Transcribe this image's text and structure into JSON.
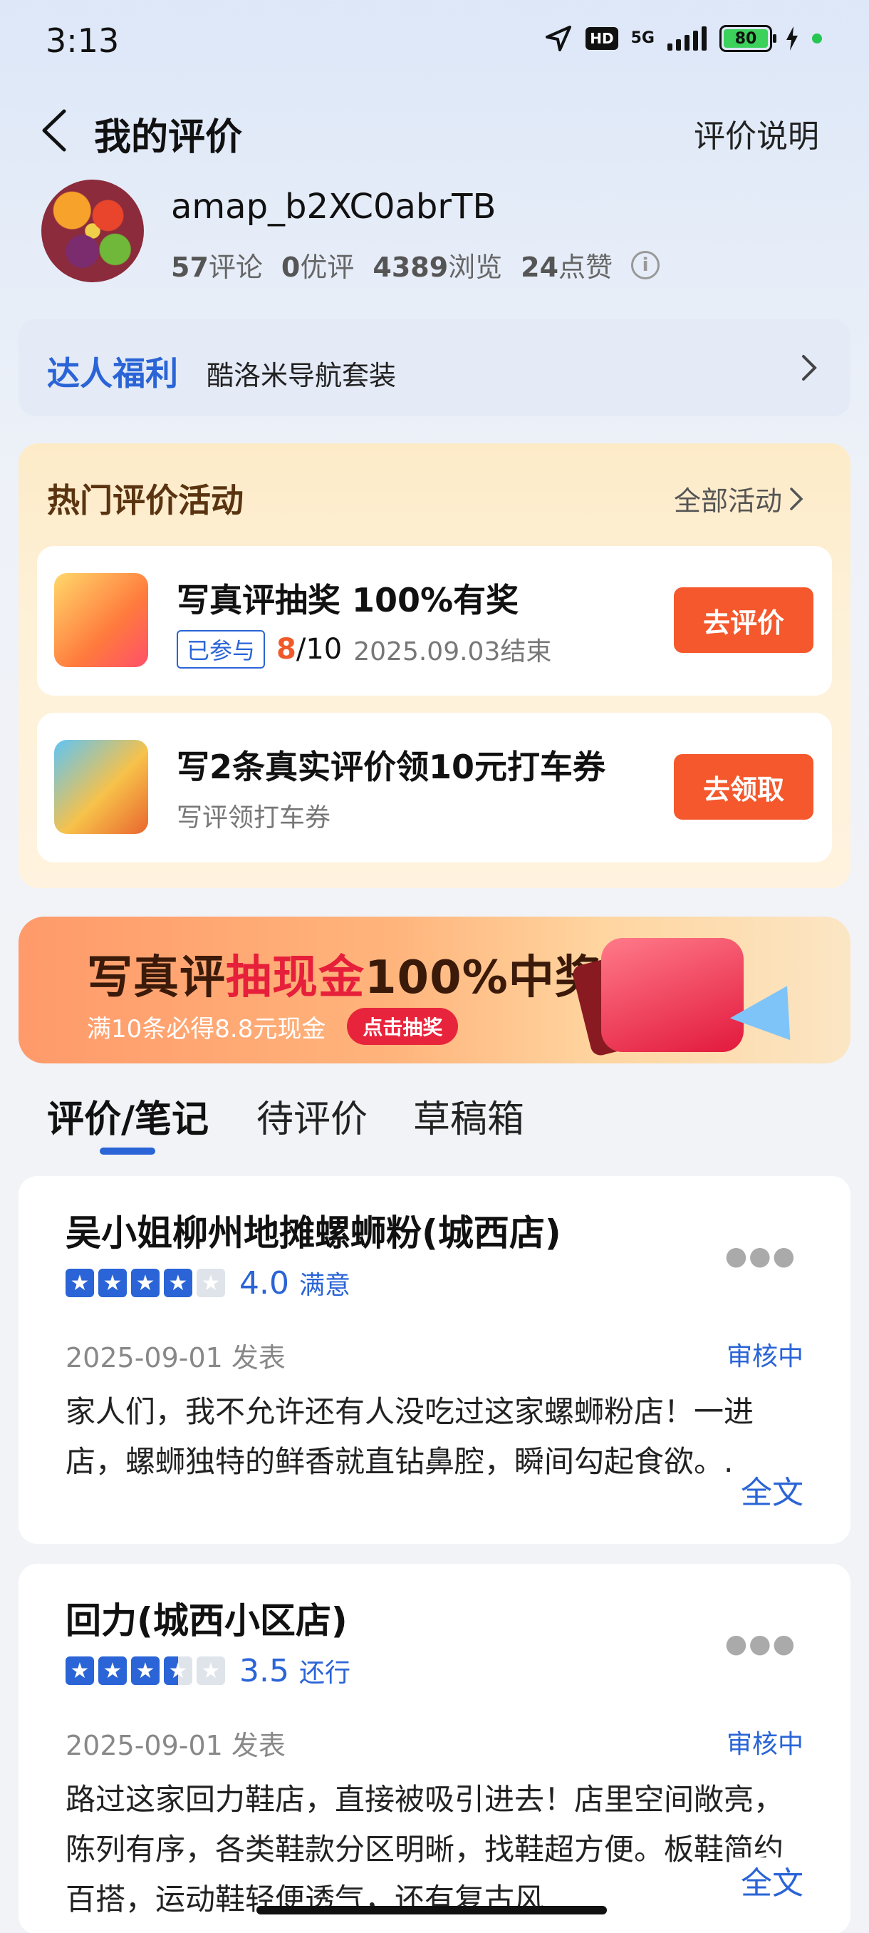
{
  "status_bar": {
    "time": "3:13",
    "hd": "HD",
    "network": "5G",
    "battery": "80"
  },
  "header": {
    "title": "我的评价",
    "right_link": "评价说明"
  },
  "profile": {
    "username": "amap_b2XC0abrTB",
    "stats": [
      {
        "value": "57",
        "label": "评论"
      },
      {
        "value": "0",
        "label": "优评"
      },
      {
        "value": "4389",
        "label": "浏览"
      },
      {
        "value": "24",
        "label": "点赞"
      }
    ]
  },
  "daren": {
    "title": "达人福利",
    "desc": "酷洛米导航套装"
  },
  "activities": {
    "title": "热门评价活动",
    "all_label": "全部活动",
    "items": [
      {
        "name": "写真评抽奖 100%有奖",
        "badge": "已参与",
        "progress_current": "8",
        "progress_total": "/10",
        "deadline": "2025.09.03结束",
        "button": "去评价"
      },
      {
        "name": "写2条真实评价领10元打车券",
        "sub": "写评领打车券",
        "button": "去领取"
      }
    ]
  },
  "banner": {
    "main_a": "写真评",
    "main_b": "抽现金",
    "main_c": "100%中奖",
    "sub": "满10条必得8.8元现金",
    "button": "点击抽奖"
  },
  "tabs": [
    {
      "label": "评价/笔记",
      "active": true
    },
    {
      "label": "待评价",
      "active": false
    },
    {
      "label": "草稿箱",
      "active": false
    }
  ],
  "reviews": [
    {
      "name": "吴小姐柳州地摊螺蛳粉(城西店)",
      "rating": 4.0,
      "score": "4.0",
      "score_word": "满意",
      "date": "2025-09-01 发表",
      "status": "审核中",
      "text": "家人们，我不允许还有人没吃过这家螺蛳粉店！一进店，螺蛳独特的鲜香就直钻鼻腔，瞬间勾起食欲。...",
      "more_label": "全文"
    },
    {
      "name": "回力(城西小区店)",
      "rating": 3.5,
      "score": "3.5",
      "score_word": "还行",
      "date": "2025-09-01 发表",
      "status": "审核中",
      "text": "路过这家回力鞋店，直接被吸引进去！店里空间敞亮，陈列有序，各类鞋款分区明晰，找鞋超方便。板鞋简约百搭，运动鞋轻便透气，还有复古风",
      "more_label": "全文"
    }
  ],
  "colors": {
    "accent": "#2a64d6",
    "cta": "#f4582c",
    "progress": "#f05a2a"
  }
}
